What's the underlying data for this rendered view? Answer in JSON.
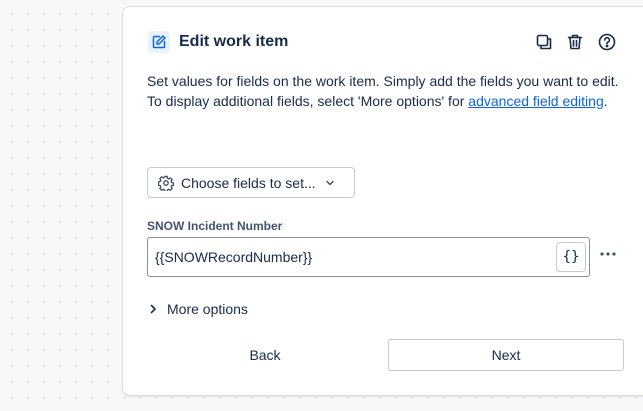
{
  "panel": {
    "title": "Edit work item",
    "header_icon": "edit-pencil-icon",
    "toolbar": {
      "duplicate_icon": "duplicate-icon",
      "delete_icon": "trash-icon",
      "help_icon": "help-icon"
    },
    "description": {
      "line1": "Set values for fields on the work item. Simply add the fields you want to edit.",
      "line2_prefix": "To display additional fields, select 'More options' for ",
      "link_text": "advanced field editing",
      "line2_suffix": "."
    },
    "choose_fields": {
      "label": "Choose fields to set...",
      "icon": "gear-icon",
      "chevron": "chevron-down-icon"
    },
    "field": {
      "label": "SNOW Incident Number",
      "value": "{{SNOWRecordNumber}}",
      "variable_button": "{}",
      "more_icon": "more-horizontal-icon"
    },
    "more_options": {
      "label": "More options",
      "icon": "chevron-right-icon"
    },
    "buttons": {
      "back": "Back",
      "next": "Next"
    }
  },
  "colors": {
    "accent": "#0c66e4",
    "text": "#172b4d",
    "subtle_text": "#44546f",
    "border": "#c7cbd1"
  }
}
